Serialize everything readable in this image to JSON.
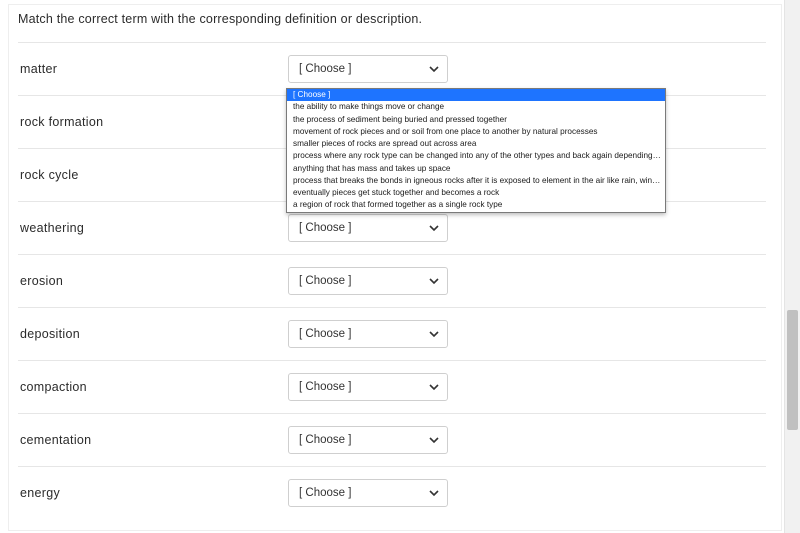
{
  "instructions": "Match the correct term with the corresponding definition or description.",
  "choose_label": "[ Choose ]",
  "terms": [
    {
      "label": "matter"
    },
    {
      "label": "rock formation"
    },
    {
      "label": "rock cycle"
    },
    {
      "label": "weathering"
    },
    {
      "label": "erosion"
    },
    {
      "label": "deposition"
    },
    {
      "label": "compaction"
    },
    {
      "label": "cementation"
    },
    {
      "label": "energy"
    }
  ],
  "dropdown": {
    "open_for_index": 0,
    "options": [
      "[ Choose ]",
      "the ability to make things move or change",
      "the process of sediment being buried and pressed together",
      "movement of rock pieces and or soil from one place to another by natural processes",
      "smaller pieces of rocks are spread out across area",
      "process where any rock type can be changed into any of the other types and back again depending on conditions",
      "anything that has mass and takes up space",
      "process that breaks the bonds in igneous rocks after it is exposed to element in the air like rain, wind, heat, ice, or pressure",
      "eventually pieces get stuck together and becomes a rock",
      "a region of rock that formed together as a single rock type"
    ],
    "selected_index": 0
  }
}
